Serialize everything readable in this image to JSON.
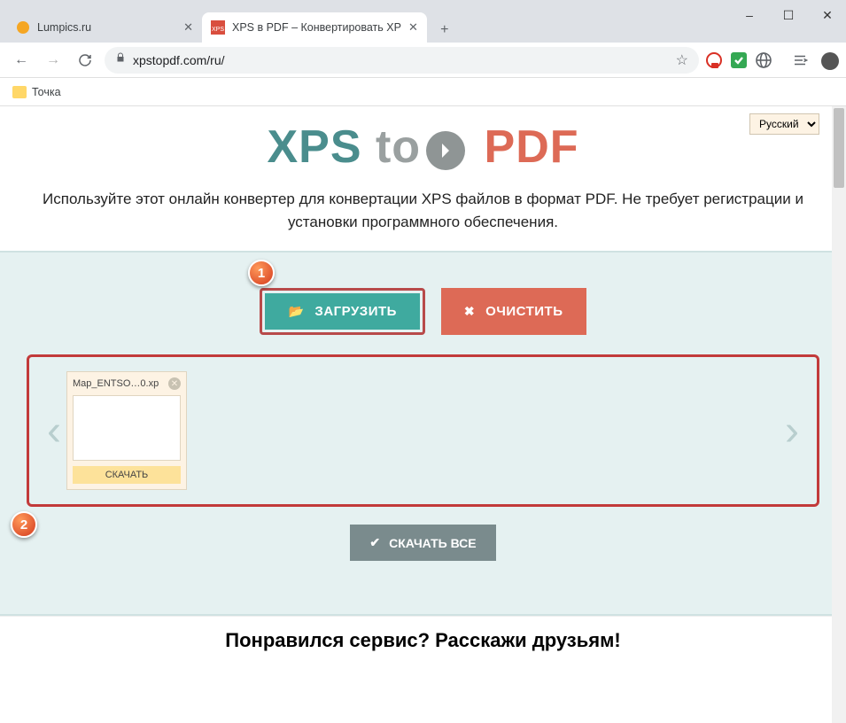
{
  "window": {
    "minimize": "–",
    "maximize": "☐",
    "close": "✕"
  },
  "tabs": [
    {
      "title": "Lumpics.ru",
      "active": false
    },
    {
      "title": "XPS в PDF – Конвертировать XP",
      "active": true
    }
  ],
  "newTab": "+",
  "nav": {
    "back": "←",
    "forward": "→",
    "reload": "↻"
  },
  "addressBar": {
    "lock": "🔒",
    "url": "xpstopdf.com/ru/",
    "star": "☆"
  },
  "bookmarks": {
    "item1": "Точка"
  },
  "langSelect": {
    "value": "Русский"
  },
  "logo": {
    "xps": "XPS",
    "to": "to",
    "pdf": "PDF"
  },
  "description": "Используйте этот онлайн конвертер для конвертации XPS файлов в формат PDF. Не требует регистрации и установки программного обеспечения.",
  "buttons": {
    "upload": "ЗАГРУЗИТЬ",
    "clear": "ОЧИСТИТЬ",
    "downloadAll": "СКАЧАТЬ ВСЕ"
  },
  "file": {
    "name": "Map_ENTSO…0.xp",
    "download": "СКАЧАТЬ"
  },
  "carousel": {
    "prev": "‹",
    "next": "›"
  },
  "share": "Понравился сервис? Расскажи друзьям!",
  "callouts": {
    "c1": "1",
    "c2": "2"
  }
}
